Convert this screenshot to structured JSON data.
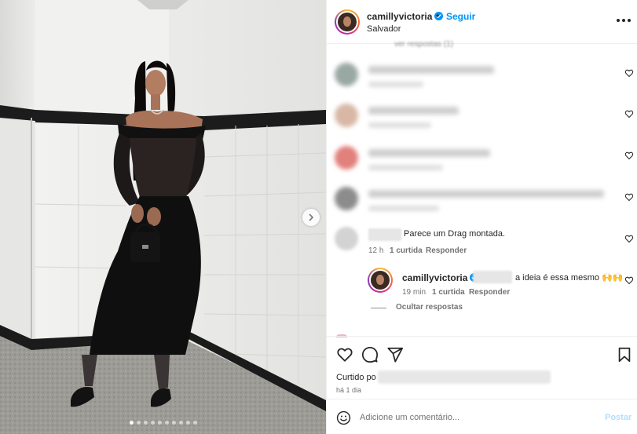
{
  "post": {
    "images": {
      "count": 10,
      "current": 1
    },
    "next_icon": "chevron-right-icon"
  },
  "header": {
    "username": "camillyvictoria",
    "verified": true,
    "separator": "•",
    "follow_label": "Seguir",
    "location": "Salvador",
    "more_icon": "more-horizontal-icon"
  },
  "comments": {
    "view_replies_label": "ver respostas (1)",
    "blurred": [
      {
        "avatar_color": "#9aa8a4"
      },
      {
        "avatar_color": "#d8b7a6"
      },
      {
        "avatar_color": "#e2807c"
      },
      {
        "avatar_color": "#8c8c8c"
      }
    ],
    "visible": {
      "text": "Parece um Drag montada.",
      "time": "12 h",
      "likes": "1 curtida",
      "reply_label": "Responder"
    },
    "reply": {
      "username": "camillyvictoria",
      "verified": true,
      "text": "a ideia é essa mesmo 🙌🙌",
      "time": "19 min",
      "likes": "1 curtida",
      "reply_label": "Responder"
    },
    "hide_replies_label": "Ocultar respostas"
  },
  "actions": {
    "icons": [
      "heart-icon",
      "comment-icon",
      "share-icon",
      "bookmark-icon"
    ],
    "liked_by_prefix": "Curtido po",
    "time_ago": "há 1 dia"
  },
  "add_comment": {
    "placeholder": "Adicione um comentário...",
    "post_label": "Postar"
  },
  "colors": {
    "accent": "#0095f6",
    "post_button_disabled": "#b2dffc",
    "verified": "#0095f6"
  }
}
